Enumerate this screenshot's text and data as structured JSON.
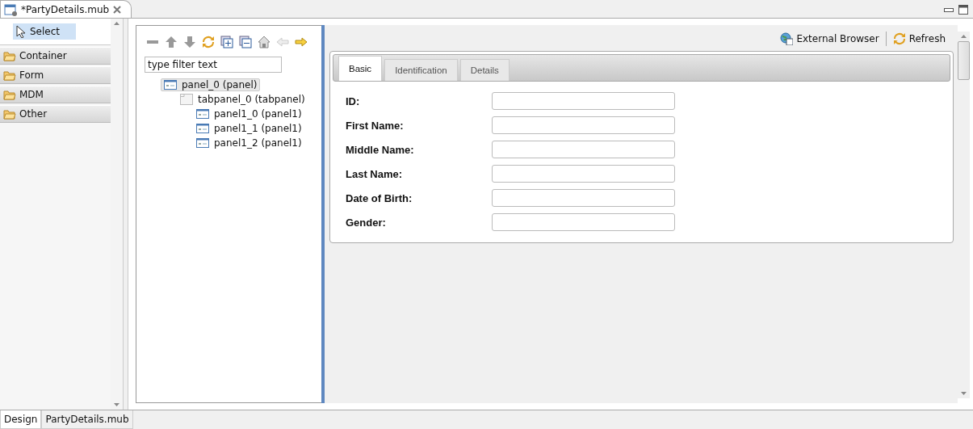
{
  "editor_tab": {
    "title": "*PartyDetails.mub"
  },
  "palette": {
    "tool": {
      "label": "Select",
      "selected": true
    },
    "drawers": [
      {
        "label": "Container"
      },
      {
        "label": "Form"
      },
      {
        "label": "MDM"
      },
      {
        "label": "Other"
      }
    ]
  },
  "outline": {
    "filter": {
      "placeholder": "type filter text"
    },
    "tree": [
      {
        "label": "panel_0 (panel)",
        "kind": "panel",
        "selected": true,
        "children": [
          {
            "label": "tabpanel_0 (tabpanel)",
            "kind": "tabpanel",
            "selected": false,
            "children": [
              {
                "label": "panel1_0 (panel1)",
                "kind": "panel",
                "selected": false
              },
              {
                "label": "panel1_1 (panel1)",
                "kind": "panel",
                "selected": false
              },
              {
                "label": "panel1_2 (panel1)",
                "kind": "panel",
                "selected": false
              }
            ]
          }
        ]
      }
    ]
  },
  "preview": {
    "actions": [
      {
        "label": "External Browser",
        "kind": "browser"
      },
      {
        "label": "Refresh",
        "kind": "refresh"
      }
    ],
    "tabs": [
      {
        "label": "Basic",
        "selected": true
      },
      {
        "label": "Identification",
        "selected": false
      },
      {
        "label": "Details",
        "selected": false
      }
    ],
    "fields": [
      {
        "label": "ID:"
      },
      {
        "label": "First Name:"
      },
      {
        "label": "Middle Name:"
      },
      {
        "label": "Last Name:"
      },
      {
        "label": "Date of Birth:"
      },
      {
        "label": "Gender:"
      }
    ]
  },
  "bottom_tabs": [
    {
      "label": "Design",
      "selected": true
    },
    {
      "label": "PartyDetails.mub",
      "selected": false
    }
  ]
}
